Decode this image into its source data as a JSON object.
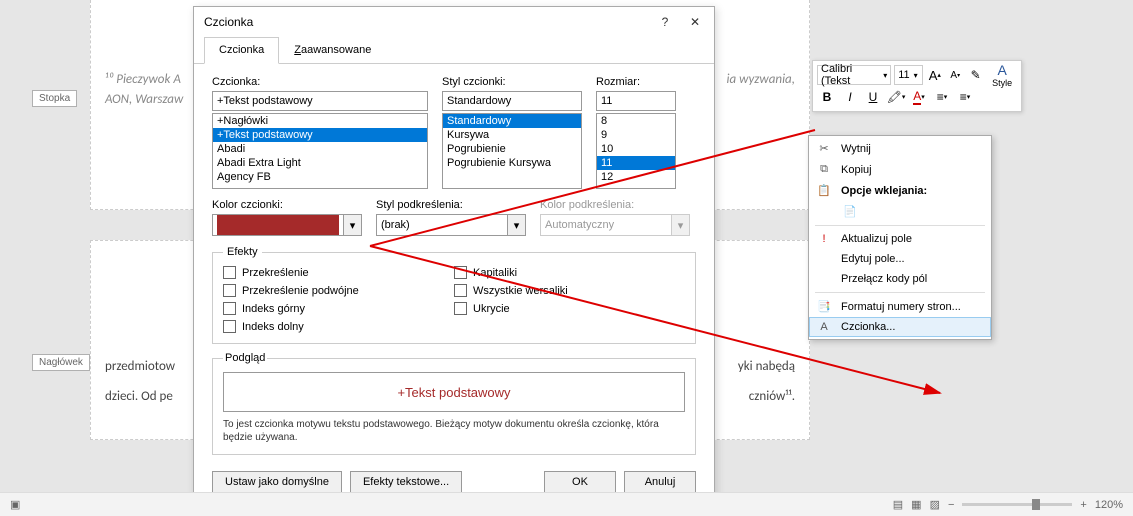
{
  "doc": {
    "footnote": "¹⁰ Pieczywok A",
    "footnote_tail": "ia wyzwania,",
    "footnote_line2": "AON, Warszaw",
    "body1": "przedmiotow",
    "body1_tail": "yki nabędą",
    "body2": "dzieci. Od pe",
    "body2_tail": "czniów¹¹.",
    "tag_stopka": "Stopka",
    "tag_naglowek": "Nagłówek"
  },
  "dialog": {
    "title": "Czcionka",
    "tabs": {
      "czcionka": "Czcionka",
      "zaawansowane": "Zaawansowane"
    },
    "labels": {
      "czcionka": "Czcionka:",
      "styl": "Styl czcionki:",
      "rozmiar": "Rozmiar:",
      "kolor": "Kolor czcionki:",
      "podkr": "Styl podkreślenia:",
      "kolor_podkr": "Kolor podkreślenia:",
      "efekty": "Efekty",
      "podglad": "Podgląd"
    },
    "font_input": "+Tekst podstawowy",
    "font_list": [
      "+Nagłówki",
      "+Tekst podstawowy",
      "Abadi",
      "Abadi Extra Light",
      "Agency FB"
    ],
    "font_sel_index": 1,
    "style_input": "Standardowy",
    "style_list": [
      "Standardowy",
      "Kursywa",
      "Pogrubienie",
      "Pogrubienie Kursywa"
    ],
    "style_sel_index": 0,
    "size_input": "11",
    "size_list": [
      "8",
      "9",
      "10",
      "11",
      "12"
    ],
    "size_sel_index": 3,
    "underline_style": "(brak)",
    "underline_color": "Automatyczny",
    "font_color_hex": "#a52a2a",
    "effects": {
      "przekreslenie": "Przekreślenie",
      "przekreslenie_podwojne": "Przekreślenie podwójne",
      "indeks_gorny": "Indeks górny",
      "indeks_dolny": "Indeks dolny",
      "kapitaliki": "Kapitaliki",
      "wszystkie_wersaliki": "Wszystkie wersaliki",
      "ukrycie": "Ukrycie"
    },
    "preview_text": "+Tekst podstawowy",
    "preview_note": "To jest czcionka motywu tekstu podstawowego. Bieżący motyw dokumentu określa czcionkę, która będzie używana.",
    "buttons": {
      "default": "Ustaw jako domyślne",
      "text_effects": "Efekty tekstowe...",
      "ok": "OK",
      "cancel": "Anuluj"
    }
  },
  "mini_toolbar": {
    "font": "Calibri (Tekst",
    "size": "11",
    "style_label": "Style"
  },
  "context_menu": {
    "wytnij": "Wytnij",
    "kopiuj": "Kopiuj",
    "opcje_wklejania": "Opcje wklejania:",
    "aktualizuj": "Aktualizuj pole",
    "edytuj": "Edytuj pole...",
    "przelacz": "Przełącz kody pól",
    "formatuj": "Formatuj numery stron...",
    "czcionka": "Czcionka..."
  },
  "statusbar": {
    "zoom": "120%"
  }
}
